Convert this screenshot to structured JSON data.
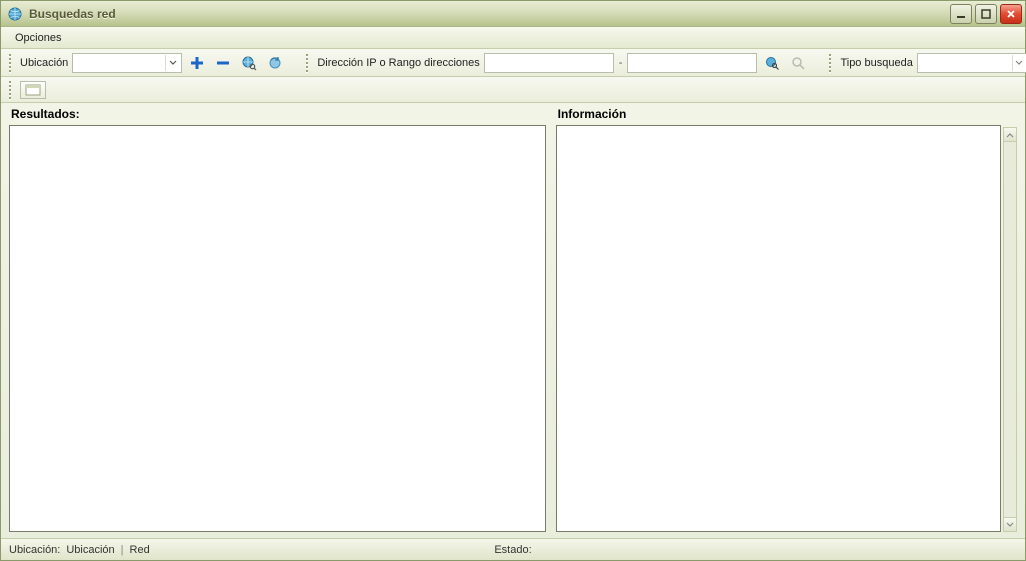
{
  "window": {
    "title": "Busquedas red"
  },
  "menubar": {
    "opciones": "Opciones"
  },
  "toolbar": {
    "ubicacion_label": "Ubicación",
    "ubicacion_value": "",
    "direccion_label": "Dirección IP o Rango direcciones",
    "ip_from": "",
    "ip_to": "",
    "tipo_label": "Tipo busqueda",
    "tipo_value": ""
  },
  "panes": {
    "resultados_header": "Resultados:",
    "informacion_header": "Información"
  },
  "statusbar": {
    "ubicacion_label": "Ubicación:",
    "ubicacion_value": "Ubicación",
    "red_value": "Red",
    "estado_label": "Estado:",
    "estado_value": ""
  }
}
